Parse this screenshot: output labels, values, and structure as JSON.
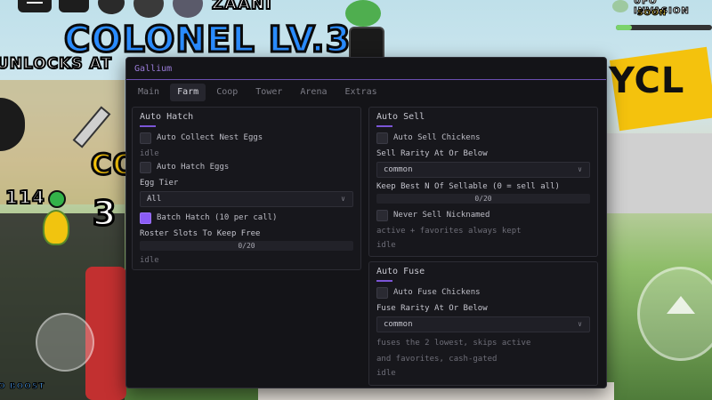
{
  "game": {
    "colonel_label": "COLONEL LV.3",
    "unlocks_label": "UNLOCKS AT",
    "player_name_fragment": "ZAANI",
    "coin_count": "114",
    "big_number": "3",
    "event_label": "UFO INVASION",
    "event_status": "SOON",
    "boost_label": "O BOOST"
  },
  "panel": {
    "title": "Gallium",
    "tabs": [
      {
        "label": "Main"
      },
      {
        "label": "Farm"
      },
      {
        "label": "Coop"
      },
      {
        "label": "Tower"
      },
      {
        "label": "Arena"
      },
      {
        "label": "Extras"
      }
    ],
    "active_tab": "Farm",
    "accent_color": "#8b5cf6",
    "auto_hatch": {
      "title": "Auto Hatch",
      "collect_label": "Auto Collect Nest Eggs",
      "collect_checked": false,
      "collect_status": "idle",
      "hatch_label": "Auto Hatch Eggs",
      "hatch_checked": false,
      "egg_tier_label": "Egg Tier",
      "egg_tier_value": "All",
      "batch_label": "Batch Hatch (10 per call)",
      "batch_checked": true,
      "roster_label": "Roster Slots To Keep Free",
      "roster_value_text": "0/20",
      "roster_fraction": 0,
      "status": "idle"
    },
    "auto_sell": {
      "title": "Auto Sell",
      "sell_label": "Auto Sell Chickens",
      "sell_checked": false,
      "rarity_label": "Sell Rarity At Or Below",
      "rarity_value": "common",
      "keep_label": "Keep Best N Of Sellable (0 = sell all)",
      "keep_value_text": "0/20",
      "keep_fraction": 0,
      "nick_label": "Never Sell Nicknamed",
      "nick_checked": false,
      "note": "active + favorites always kept",
      "status": "idle"
    },
    "auto_fuse": {
      "title": "Auto Fuse",
      "fuse_label": "Auto Fuse Chickens",
      "fuse_checked": false,
      "rarity_label": "Fuse Rarity At Or Below",
      "rarity_value": "common",
      "note_line1": "fuses the 2 lowest, skips active",
      "note_line2": "and favorites, cash-gated",
      "status": "idle"
    }
  }
}
